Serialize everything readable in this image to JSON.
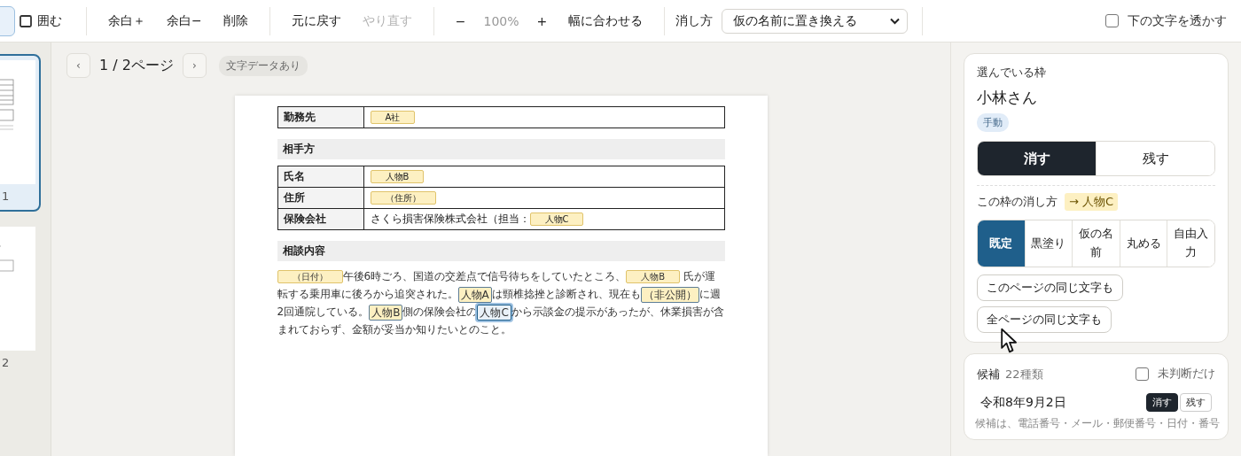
{
  "toolbar": {
    "tools": [
      {
        "selected": true
      },
      {
        "label": "囲む",
        "selected": false
      }
    ],
    "groups": [
      [
        {
          "label": "余白＋",
          "disabled": false
        },
        {
          "label": "余白−",
          "disabled": false
        },
        {
          "label": "削除",
          "disabled": false
        }
      ],
      [
        {
          "label": "元に戻す",
          "disabled": false
        },
        {
          "label": "やり直す",
          "disabled": true
        }
      ]
    ],
    "zoom": {
      "minus": "−",
      "value": "100%",
      "plus": "+",
      "fit": "幅に合わせる"
    },
    "method": {
      "label": "消し方",
      "value": "仮の名前に置き換える"
    },
    "show_through": {
      "label": "下の文字を透かす",
      "checked": false
    }
  },
  "thumbnails": [
    {
      "label": "1",
      "selected": true
    },
    {
      "label": "2",
      "selected": false
    }
  ],
  "pager": {
    "prev": "‹",
    "page": "1 / 2ページ",
    "next": "›",
    "badge": "文字データあり"
  },
  "document": [
    {
      "kind": "table",
      "rows": [
        {
          "label": "勤務先",
          "value": [
            {
              "kind": "mask",
              "text": "A社",
              "outlined": false,
              "selected": false
            }
          ]
        }
      ]
    },
    {
      "kind": "heading",
      "text": "相手方"
    },
    {
      "kind": "table",
      "rows": [
        {
          "label": "氏名",
          "value": [
            {
              "kind": "mask",
              "text": "人物B",
              "outlined": false,
              "selected": false
            }
          ]
        },
        {
          "label": "住所",
          "value": [
            {
              "kind": "mask",
              "text": "（住所）",
              "outlined": false,
              "selected": false
            }
          ]
        },
        {
          "label": "保険会社",
          "value": [
            {
              "kind": "text",
              "text": "さくら損害保険株式会社（担当："
            },
            {
              "kind": "mask",
              "text": "人物C",
              "outlined": false,
              "selected": false
            }
          ]
        }
      ]
    },
    {
      "kind": "heading",
      "text": "相談内容"
    },
    {
      "kind": "paragraph",
      "segments": [
        {
          "kind": "mask",
          "text": "（日付）",
          "outlined": false,
          "selected": false
        },
        {
          "kind": "text",
          "text": "午後6時ごろ、国道の交差点で信号待ちをしていたところ、"
        },
        {
          "kind": "mask",
          "text": "人物B",
          "outlined": false,
          "selected": false
        },
        {
          "kind": "text",
          "text": " 氏が運転する乗用車に後ろから追突された。"
        },
        {
          "kind": "mask",
          "text": "人物A",
          "outlined": true,
          "selected": false
        },
        {
          "kind": "text",
          "text": "は頸椎捻挫と診断され、現在も"
        },
        {
          "kind": "mask",
          "text": "（非公開）",
          "outlined": true,
          "selected": false
        },
        {
          "kind": "text",
          "text": "に週2回通院している。"
        },
        {
          "kind": "mask",
          "text": "人物B",
          "outlined": true,
          "selected": false
        },
        {
          "kind": "text",
          "text": "側の保険会社の"
        },
        {
          "kind": "mask",
          "text": "人物C",
          "outlined": true,
          "selected": true
        },
        {
          "kind": "text",
          "text": "から示談金の提示があったが、休業損害が含まれておらず、金額が妥当か知りたいとのこと。"
        }
      ]
    }
  ],
  "selection": {
    "title": "選んでいる枠",
    "name": "小林さん",
    "badge": "手動",
    "actions": [
      {
        "label": "消す",
        "selected": true
      },
      {
        "label": "残す",
        "selected": false
      }
    ],
    "method_label": "この枠の消し方",
    "method_result": "→ 人物C",
    "methods": [
      {
        "label": "既定",
        "selected": true
      },
      {
        "label": "黒塗り",
        "selected": false
      },
      {
        "label": "仮の名前",
        "selected": false
      },
      {
        "label": "丸める",
        "selected": false
      },
      {
        "label": "自由入力",
        "selected": false
      }
    ],
    "apply": [
      "このページの同じ文字も",
      "全ページの同じ文字も"
    ]
  },
  "candidates": {
    "title": "候補",
    "count": "22種類",
    "filter": {
      "label": "未判断だけ",
      "checked": false
    },
    "items": [
      {
        "text": "令和8年9月2日",
        "actions": [
          {
            "label": "消す",
            "selected": true
          },
          {
            "label": "残す",
            "selected": false
          }
        ]
      }
    ],
    "hint": "候補は、電話番号・メール・郵便番号・日付・番号"
  }
}
